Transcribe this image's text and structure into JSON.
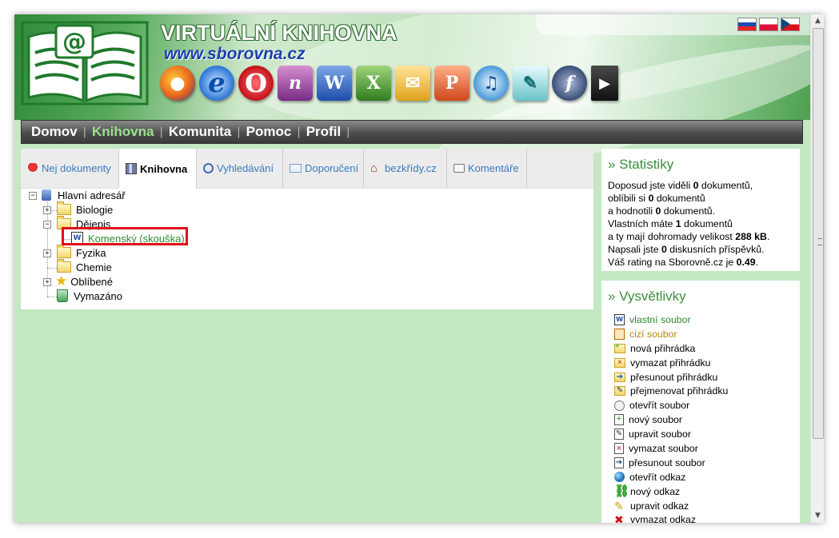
{
  "header": {
    "title": "VIRTUÁLNÍ KNIHOVNA",
    "url": "www.sborovna.cz",
    "app_icons": [
      "firefox-icon",
      "internet-explorer-icon",
      "opera-icon",
      "onenote-icon",
      "word-icon",
      "excel-icon",
      "outlook-icon",
      "powerpoint-icon",
      "itunes-icon",
      "feather-icon",
      "flash-icon",
      "avi-icon"
    ],
    "flags": [
      "slovak-flag",
      "polish-flag",
      "czech-flag"
    ]
  },
  "nav": {
    "items": [
      {
        "label": "Domov",
        "active": false
      },
      {
        "label": "Knihovna",
        "active": true
      },
      {
        "label": "Komunita",
        "active": false
      },
      {
        "label": "Pomoc",
        "active": false
      },
      {
        "label": "Profil",
        "active": false
      }
    ],
    "separator": "|"
  },
  "tabs": [
    {
      "label": "Nej dokumenty",
      "icon": "award-icon",
      "active": false
    },
    {
      "label": "Knihovna",
      "icon": "library-icon",
      "active": true
    },
    {
      "label": "Vyhledávání",
      "icon": "search-icon",
      "active": false
    },
    {
      "label": "Doporučení",
      "icon": "envelope-icon",
      "active": false
    },
    {
      "label": "bezkřídy.cz",
      "icon": "home-icon",
      "active": false
    },
    {
      "label": "Komentáře",
      "icon": "comments-icon",
      "active": false
    }
  ],
  "tree": {
    "root": "Hlavní adresář",
    "items": [
      {
        "label": "Biologie"
      },
      {
        "label": "Dějepis"
      },
      {
        "label": "Komenský (skouška)"
      },
      {
        "label": "Fyzika"
      },
      {
        "label": "Chemie"
      },
      {
        "label": "Oblíbené"
      },
      {
        "label": "Vymazáno"
      }
    ]
  },
  "stats": {
    "title": "» Statistiky",
    "l1a": "Doposud jste viděli ",
    "l1b": "0",
    "l1c": " dokumentů,",
    "l2a": "oblíbili si ",
    "l2b": "0",
    "l2c": " dokumentů",
    "l3a": "a hodnotili ",
    "l3b": "0",
    "l3c": " dokumentů.",
    "l4a": "Vlastních máte ",
    "l4b": "1",
    "l4c": " dokumentů",
    "l5a": "a ty mají dohromady velikost ",
    "l5b": "288 kB",
    "l5c": ".",
    "l6a": "Napsali jste ",
    "l6b": "0",
    "l6c": " diskusních příspěvků.",
    "l7a": "Váš rating na Sborovně.cz je ",
    "l7b": "0.49",
    "l7c": "."
  },
  "legend": {
    "title": "» Vysvětlivky",
    "items": [
      {
        "label": "vlastní soubor",
        "color": "#2e8b2e"
      },
      {
        "label": "cizí soubor",
        "color": "#b8860b"
      },
      {
        "label": "nová přihrádka",
        "color": "#000000"
      },
      {
        "label": "vymazat přihrádku",
        "color": "#000000"
      },
      {
        "label": "přesunout přihrádku",
        "color": "#000000"
      },
      {
        "label": "přejmenovat přihrádku",
        "color": "#000000"
      },
      {
        "label": "otevřít soubor",
        "color": "#000000"
      },
      {
        "label": "nový soubor",
        "color": "#000000"
      },
      {
        "label": "upravit soubor",
        "color": "#000000"
      },
      {
        "label": "vymazat soubor",
        "color": "#000000"
      },
      {
        "label": "přesunout soubor",
        "color": "#000000"
      },
      {
        "label": "otevřít odkaz",
        "color": "#000000"
      },
      {
        "label": "nový odkaz",
        "color": "#000000"
      },
      {
        "label": "upravit odkaz",
        "color": "#000000"
      },
      {
        "label": "vymazat odkaz",
        "color": "#000000"
      }
    ]
  },
  "colors": {
    "background": "#c4e8c2",
    "accent_green": "#3d8e3d",
    "link_blue": "#3a7abf",
    "highlight_red": "#e2101a"
  }
}
